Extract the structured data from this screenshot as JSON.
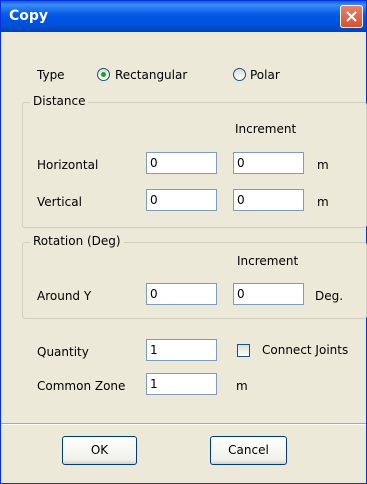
{
  "window": {
    "title": "Copy"
  },
  "type_row": {
    "label": "Type",
    "options": [
      {
        "label": "Rectangular",
        "selected": true
      },
      {
        "label": "Polar",
        "selected": false
      }
    ]
  },
  "distance": {
    "legend": "Distance",
    "increment_header": "Increment",
    "rows": [
      {
        "label": "Horizontal",
        "value": "0",
        "increment": "0",
        "unit": "m"
      },
      {
        "label": "Vertical",
        "value": "0",
        "increment": "0",
        "unit": "m"
      }
    ]
  },
  "rotation": {
    "legend": "Rotation (Deg)",
    "increment_header": "Increment",
    "rows": [
      {
        "label": "Around Y",
        "value": "0",
        "increment": "0",
        "unit": "Deg."
      }
    ]
  },
  "quantity": {
    "label": "Quantity",
    "value": "1"
  },
  "connect_joints": {
    "label": "Connect Joints",
    "checked": false
  },
  "common_zone": {
    "label": "Common Zone",
    "value": "1",
    "unit": "m"
  },
  "buttons": {
    "ok": "OK",
    "cancel": "Cancel"
  },
  "colors": {
    "title_bar": "#0058E6",
    "dialog_bg": "#ECE9D8",
    "radio_dot": "#21A121"
  }
}
